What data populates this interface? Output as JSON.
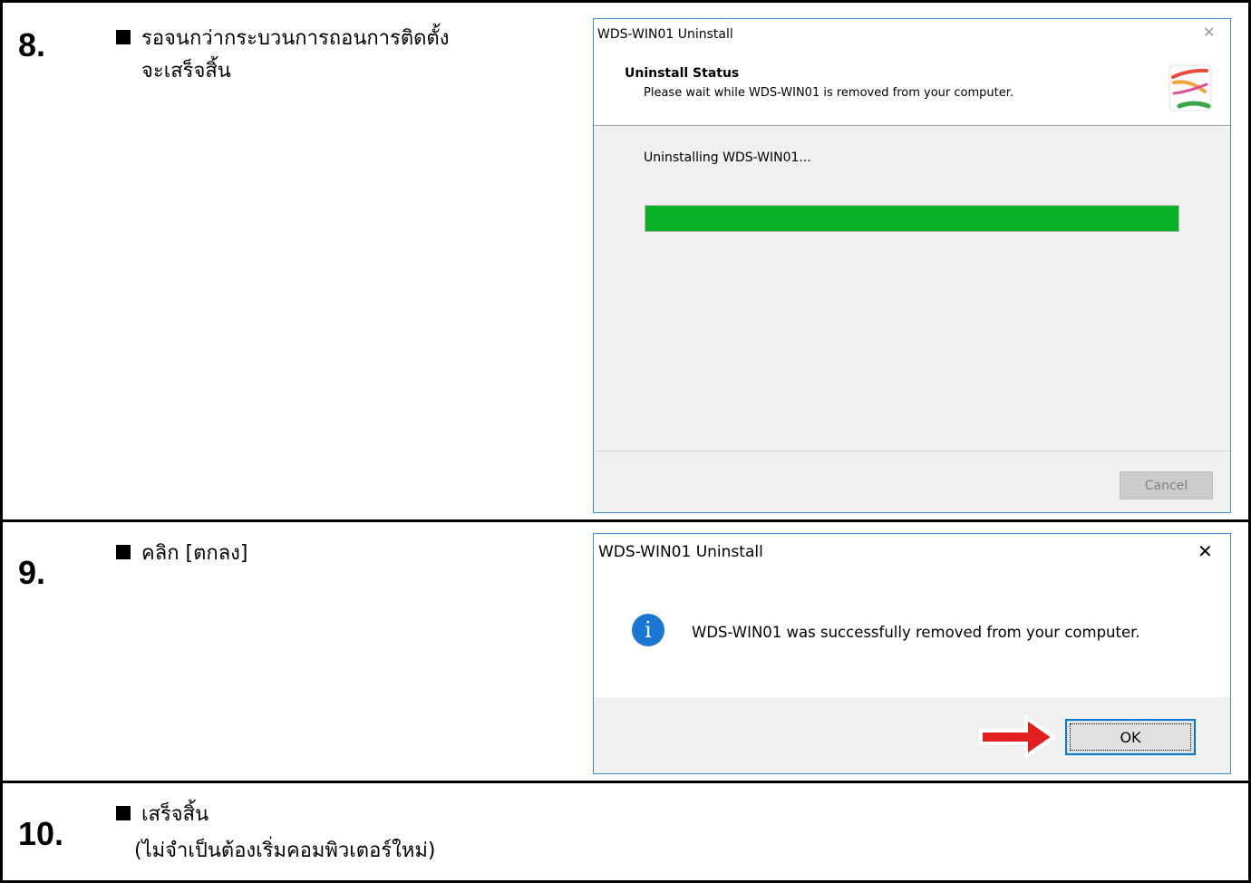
{
  "steps": [
    {
      "number": "8.",
      "lines": [
        "รอจนกว่ากระบวนการถอนการติดตั้ง",
        "จะเสร็จสิ้น"
      ]
    },
    {
      "number": "9.",
      "lines": [
        "คลิก   [ตกลง]"
      ]
    },
    {
      "number": "10.",
      "lines": [
        "เสร็จสิ้น",
        "(ไม่จำเป็นต้องเริ่มคอมพิวเตอร์ใหม่)"
      ]
    }
  ],
  "uninstall_dialog": {
    "title": "WDS-WIN01 Uninstall",
    "close_glyph": "✕",
    "header_title": "Uninstall Status",
    "header_subtitle": "Please wait while WDS-WIN01 is removed from your computer.",
    "status_text": "Uninstalling WDS-WIN01...",
    "progress_percent": 100,
    "progress_color": "#06b025",
    "cancel_label": "Cancel",
    "cancel_enabled": false,
    "logo_icon": "installer-logo-icon"
  },
  "success_dialog": {
    "title": "WDS-WIN01 Uninstall",
    "close_glyph": "✕",
    "info_icon": "info-icon",
    "info_glyph": "i",
    "message": "WDS-WIN01 was successfully removed from your computer.",
    "ok_label": "OK",
    "accent_color": "#0078d7"
  },
  "annotation": {
    "arrow_icon": "red-arrow-icon",
    "arrow_color": "#e31e1e"
  }
}
